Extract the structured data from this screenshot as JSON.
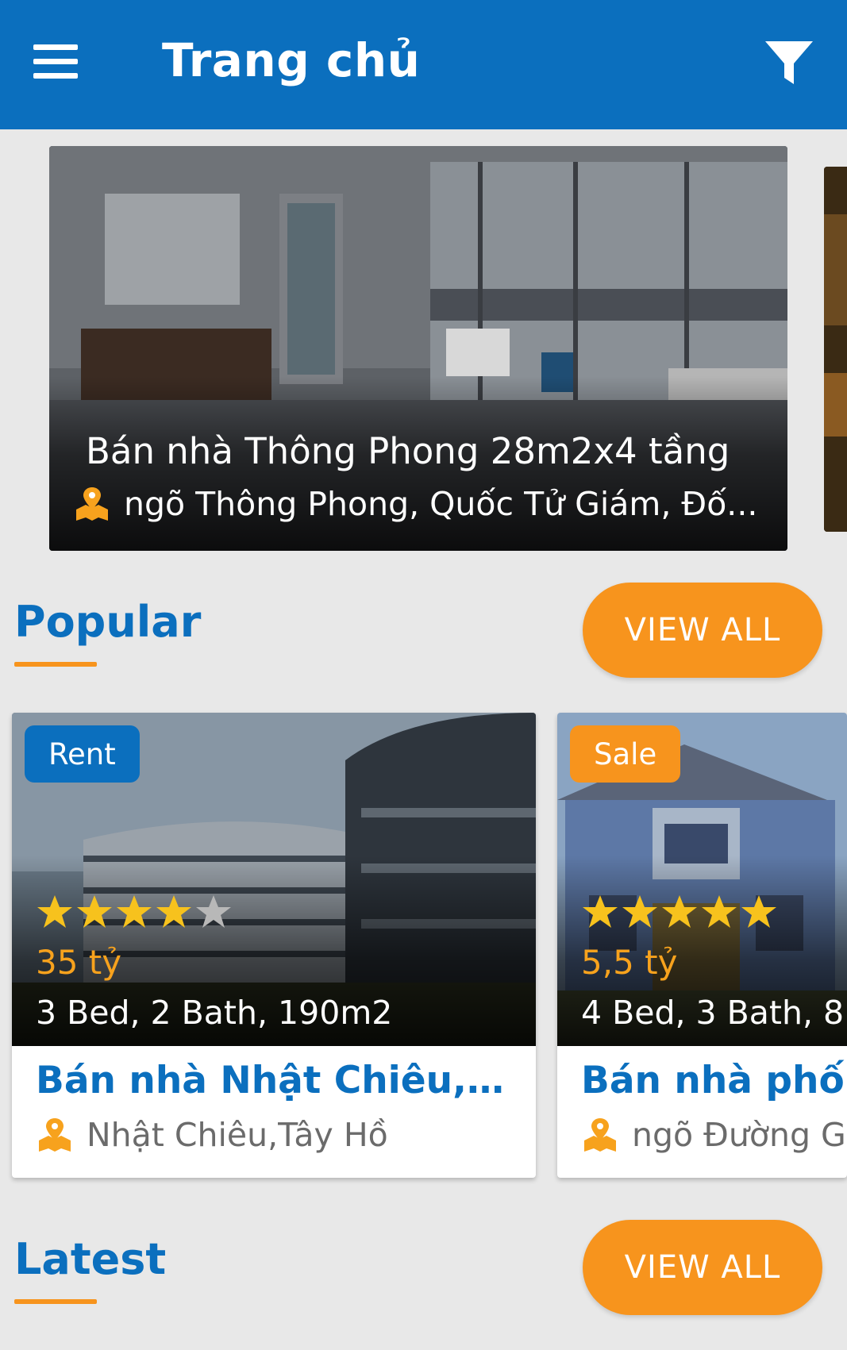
{
  "appbar": {
    "title": "Trang chủ",
    "menu_icon": "hamburger-menu-icon",
    "filter_icon": "filter-funnel-icon",
    "color": "#0b6fbe"
  },
  "featured": {
    "title": "Bán nhà Thông Phong 28m2x4 tầng",
    "address": "ngõ Thông Phong, Quốc Tử Giám, Đố...",
    "address_icon": "map-location-icon"
  },
  "popular": {
    "heading": "Popular",
    "view_all_label": "VIEW ALL",
    "items": [
      {
        "badge": "Rent",
        "badge_color": "#0b6fbe",
        "rating": 4,
        "rating_max": 5,
        "price": "35 tỷ",
        "specs": "3 Bed, 2 Bath, 190m2",
        "title": "Bán nhà Nhật Chiêu,Tây...",
        "address": "Nhật Chiêu,Tây Hồ"
      },
      {
        "badge": "Sale",
        "badge_color": "#f7941d",
        "rating": 5,
        "rating_max": 5,
        "price": "5,5 tỷ",
        "specs": "4 Bed, 3 Bath, 8",
        "title": "Bán nhà phố G",
        "address": "ngõ Đường G"
      }
    ]
  },
  "latest": {
    "heading": "Latest",
    "view_all_label": "VIEW ALL"
  },
  "colors": {
    "primary": "#0b6fbe",
    "accent": "#f7941d",
    "background": "#e8e8e8",
    "star_filled": "#f7c21d",
    "star_empty": "#b8b8b8"
  }
}
